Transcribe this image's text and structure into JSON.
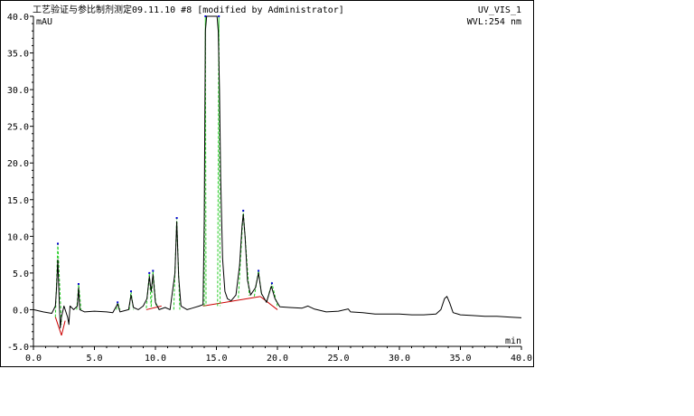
{
  "header": {
    "title": "工艺验证与参比制剂测定09.11.10 #8 [modified by Administrator]",
    "channel": "UV_VIS_1",
    "wavelength": "WVL:254 nm"
  },
  "chart_data": {
    "type": "line",
    "title": "工艺验证与参比制剂测定09.11.10 #8 [modified by Administrator]",
    "ylabel": "mAU",
    "xlabel": "min",
    "xlim": [
      0,
      40
    ],
    "ylim": [
      -5,
      40
    ],
    "x_ticks": [
      "0.0",
      "5.0",
      "10.0",
      "15.0",
      "20.0",
      "25.0",
      "30.0",
      "35.0",
      "40.0"
    ],
    "y_ticks": [
      "-5.0",
      "0.0",
      "5.0",
      "10.0",
      "15.0",
      "20.0",
      "25.0",
      "30.0",
      "35.0",
      "40.0"
    ],
    "colors": {
      "signal": "#000000",
      "peak_fit": "#22cc22",
      "baseline": "#cc0000",
      "peak_marker": "#0000cc"
    },
    "series": [
      {
        "values": [
          [
            0.0,
            0.0
          ],
          [
            0.8,
            -0.3
          ],
          [
            1.5,
            -0.5
          ],
          [
            1.8,
            0.5
          ],
          [
            1.9,
            3.0
          ],
          [
            2.0,
            6.8
          ],
          [
            2.1,
            2.0
          ],
          [
            2.2,
            -2.5
          ],
          [
            2.3,
            -1.0
          ],
          [
            2.5,
            0.5
          ],
          [
            2.8,
            -1.0
          ],
          [
            2.9,
            -2.0
          ],
          [
            3.0,
            0.5
          ],
          [
            3.3,
            0.0
          ],
          [
            3.6,
            0.5
          ],
          [
            3.7,
            3.0
          ],
          [
            3.8,
            0.0
          ],
          [
            4.2,
            -0.3
          ],
          [
            5.0,
            -0.2
          ],
          [
            6.0,
            -0.3
          ],
          [
            6.5,
            -0.4
          ],
          [
            6.9,
            0.8
          ],
          [
            7.1,
            -0.3
          ],
          [
            7.8,
            0.0
          ],
          [
            8.0,
            2.0
          ],
          [
            8.2,
            0.3
          ],
          [
            8.6,
            0.0
          ],
          [
            9.0,
            0.5
          ],
          [
            9.3,
            1.5
          ],
          [
            9.5,
            4.5
          ],
          [
            9.65,
            2.5
          ],
          [
            9.8,
            4.8
          ],
          [
            10.0,
            1.0
          ],
          [
            10.3,
            0.0
          ],
          [
            10.8,
            0.3
          ],
          [
            11.2,
            0.0
          ],
          [
            11.6,
            5.0
          ],
          [
            11.75,
            12.0
          ],
          [
            11.9,
            4.5
          ],
          [
            12.1,
            0.5
          ],
          [
            12.6,
            0.0
          ],
          [
            13.0,
            0.2
          ],
          [
            13.6,
            0.5
          ],
          [
            13.9,
            0.7
          ],
          [
            14.0,
            12.0
          ],
          [
            14.1,
            38.0
          ],
          [
            14.2,
            40.0
          ],
          [
            14.8,
            40.0
          ],
          [
            15.05,
            40.0
          ],
          [
            15.15,
            38.0
          ],
          [
            15.25,
            30.0
          ],
          [
            15.35,
            18.0
          ],
          [
            15.5,
            7.0
          ],
          [
            15.7,
            2.5
          ],
          [
            15.9,
            1.5
          ],
          [
            16.2,
            1.2
          ],
          [
            16.6,
            2.0
          ],
          [
            16.9,
            6.0
          ],
          [
            17.1,
            11.5
          ],
          [
            17.2,
            13.0
          ],
          [
            17.35,
            10.0
          ],
          [
            17.55,
            4.0
          ],
          [
            17.8,
            2.0
          ],
          [
            18.2,
            3.0
          ],
          [
            18.45,
            5.0
          ],
          [
            18.7,
            2.2
          ],
          [
            19.1,
            1.0
          ],
          [
            19.5,
            3.2
          ],
          [
            19.8,
            1.5
          ],
          [
            20.2,
            0.4
          ],
          [
            21.0,
            0.3
          ],
          [
            22.0,
            0.2
          ],
          [
            22.5,
            0.5
          ],
          [
            23.0,
            0.1
          ],
          [
            24.0,
            -0.3
          ],
          [
            25.0,
            -0.2
          ],
          [
            25.8,
            0.1
          ],
          [
            26.0,
            -0.3
          ],
          [
            27.0,
            -0.4
          ],
          [
            28.0,
            -0.6
          ],
          [
            29.0,
            -0.6
          ],
          [
            30.0,
            -0.6
          ],
          [
            31.0,
            -0.7
          ],
          [
            32.0,
            -0.7
          ],
          [
            33.0,
            -0.6
          ],
          [
            33.4,
            0.0
          ],
          [
            33.7,
            1.5
          ],
          [
            33.9,
            1.8
          ],
          [
            34.1,
            1.0
          ],
          [
            34.4,
            -0.4
          ],
          [
            35.0,
            -0.7
          ],
          [
            36.0,
            -0.8
          ],
          [
            37.0,
            -0.9
          ],
          [
            38.0,
            -0.9
          ],
          [
            39.0,
            -1.0
          ],
          [
            40.0,
            -1.1
          ]
        ]
      }
    ],
    "peaks": [
      {
        "apex": [
          2.0,
          9.0
        ],
        "start": [
          1.8,
          -1.0
        ],
        "end": [
          2.3,
          -2.0
        ]
      },
      {
        "apex": [
          3.7,
          3.5
        ],
        "start": [
          3.55,
          0.0
        ],
        "end": [
          3.9,
          0.0
        ]
      },
      {
        "apex": [
          6.9,
          1.0
        ],
        "start": [
          6.8,
          0.0
        ],
        "end": [
          7.1,
          0.0
        ]
      },
      {
        "apex": [
          8.0,
          2.5
        ],
        "start": [
          7.85,
          0.0
        ],
        "end": [
          8.2,
          0.0
        ]
      },
      {
        "apex": [
          9.5,
          5.0
        ],
        "start": [
          9.25,
          0.2
        ],
        "end": [
          9.65,
          0.4
        ]
      },
      {
        "apex": [
          9.8,
          5.3
        ],
        "start": [
          9.65,
          0.4
        ],
        "end": [
          10.05,
          0.4
        ]
      },
      {
        "apex": [
          11.75,
          12.5
        ],
        "start": [
          11.5,
          0.0
        ],
        "end": [
          12.0,
          0.0
        ]
      },
      {
        "apex": [
          14.1,
          40.0
        ],
        "start": [
          14.0,
          0.5
        ],
        "end": [
          14.15,
          0.5
        ]
      },
      {
        "apex": [
          15.2,
          40.0
        ],
        "start": [
          15.1,
          0.5
        ],
        "end": [
          15.3,
          0.5
        ]
      },
      {
        "apex": [
          17.2,
          13.5
        ],
        "start": [
          16.8,
          1.6
        ],
        "end": [
          17.7,
          1.9
        ]
      },
      {
        "apex": [
          18.45,
          5.3
        ],
        "start": [
          18.1,
          1.8
        ],
        "end": [
          18.7,
          2.0
        ]
      },
      {
        "apex": [
          19.55,
          3.6
        ],
        "start": [
          19.1,
          1.0
        ],
        "end": [
          20.0,
          0.5
        ]
      }
    ],
    "baselines": [
      [
        [
          1.8,
          -1.0
        ],
        [
          2.3,
          -3.5
        ]
      ],
      [
        [
          2.3,
          -3.5
        ],
        [
          2.6,
          -1.5
        ]
      ],
      [
        [
          9.25,
          0.0
        ],
        [
          10.5,
          0.5
        ]
      ],
      [
        [
          13.9,
          0.5
        ],
        [
          18.6,
          1.8
        ]
      ],
      [
        [
          18.6,
          1.8
        ],
        [
          20.0,
          0.0
        ]
      ]
    ]
  }
}
